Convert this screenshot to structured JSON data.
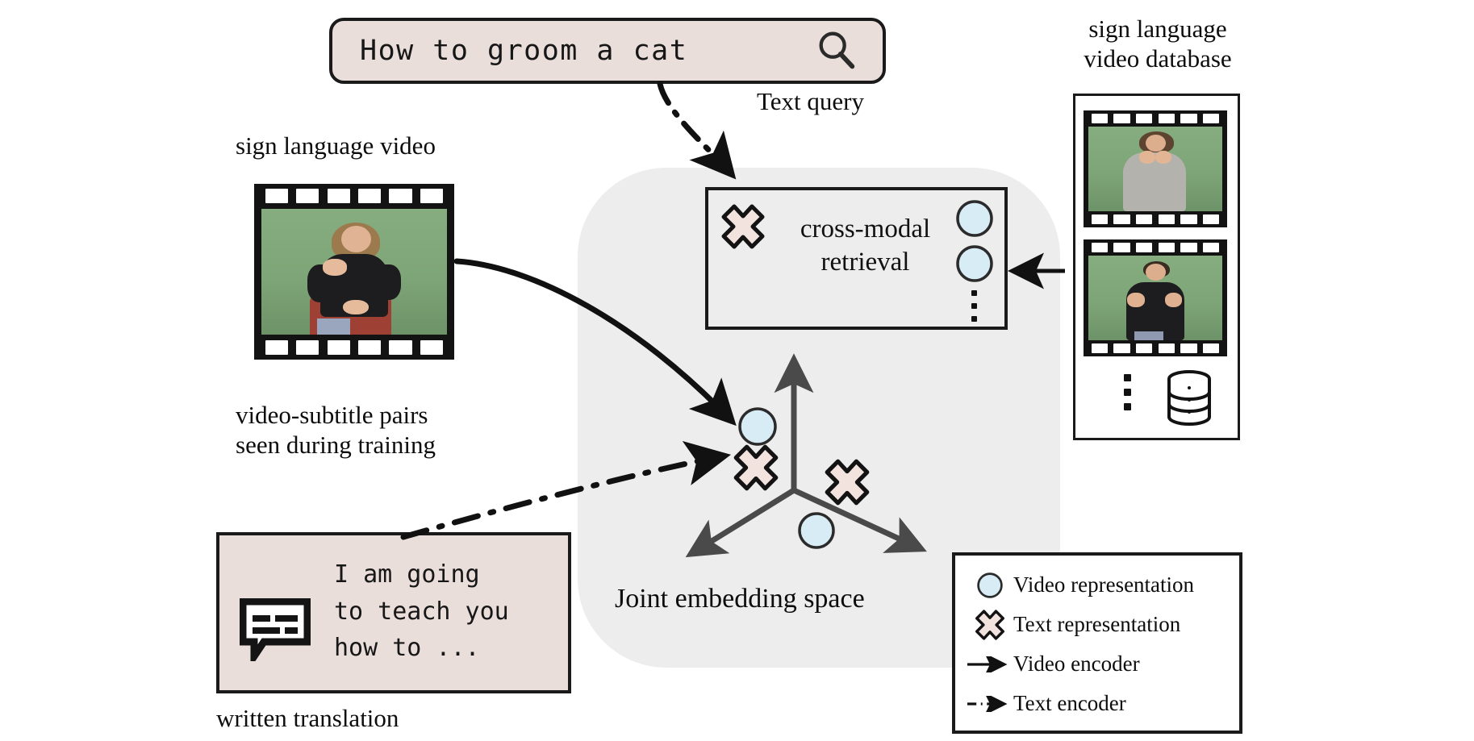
{
  "query": {
    "text": "How to groom a cat",
    "icon": "search-icon",
    "caption": "Text query",
    "box_fill": "#eadedb"
  },
  "left": {
    "video_caption": "sign language video",
    "pairs_caption": "video-subtitle pairs\nseen during training",
    "translation_caption": "written translation",
    "subtitle_text": "I am going\nto teach you\nhow to ...",
    "subtitle_icon": "subtitle-bubble-icon"
  },
  "center": {
    "retrieval_label": "cross-modal\nretrieval",
    "joint_space_label": "Joint  embedding space",
    "region_fill": "#ededed"
  },
  "right": {
    "database_caption": "sign language\nvideo database",
    "database_icon": "database-cylinder-icon",
    "ellipsis": "vertical-ellipsis"
  },
  "legend": {
    "items": [
      {
        "symbol": "circle-marker",
        "label": "Video representation"
      },
      {
        "symbol": "cross-marker",
        "label": "Text representation"
      },
      {
        "symbol": "solid-arrow",
        "label": "Video encoder"
      },
      {
        "symbol": "dash-dot-arrow",
        "label": "Text encoder"
      }
    ]
  },
  "colors": {
    "video_marker_fill": "#d8ecf5",
    "text_marker_fill": "#f3e3de",
    "box_outline": "#1a1a1a",
    "axis": "#4a4a4a",
    "green_screen": "#7aa878"
  }
}
